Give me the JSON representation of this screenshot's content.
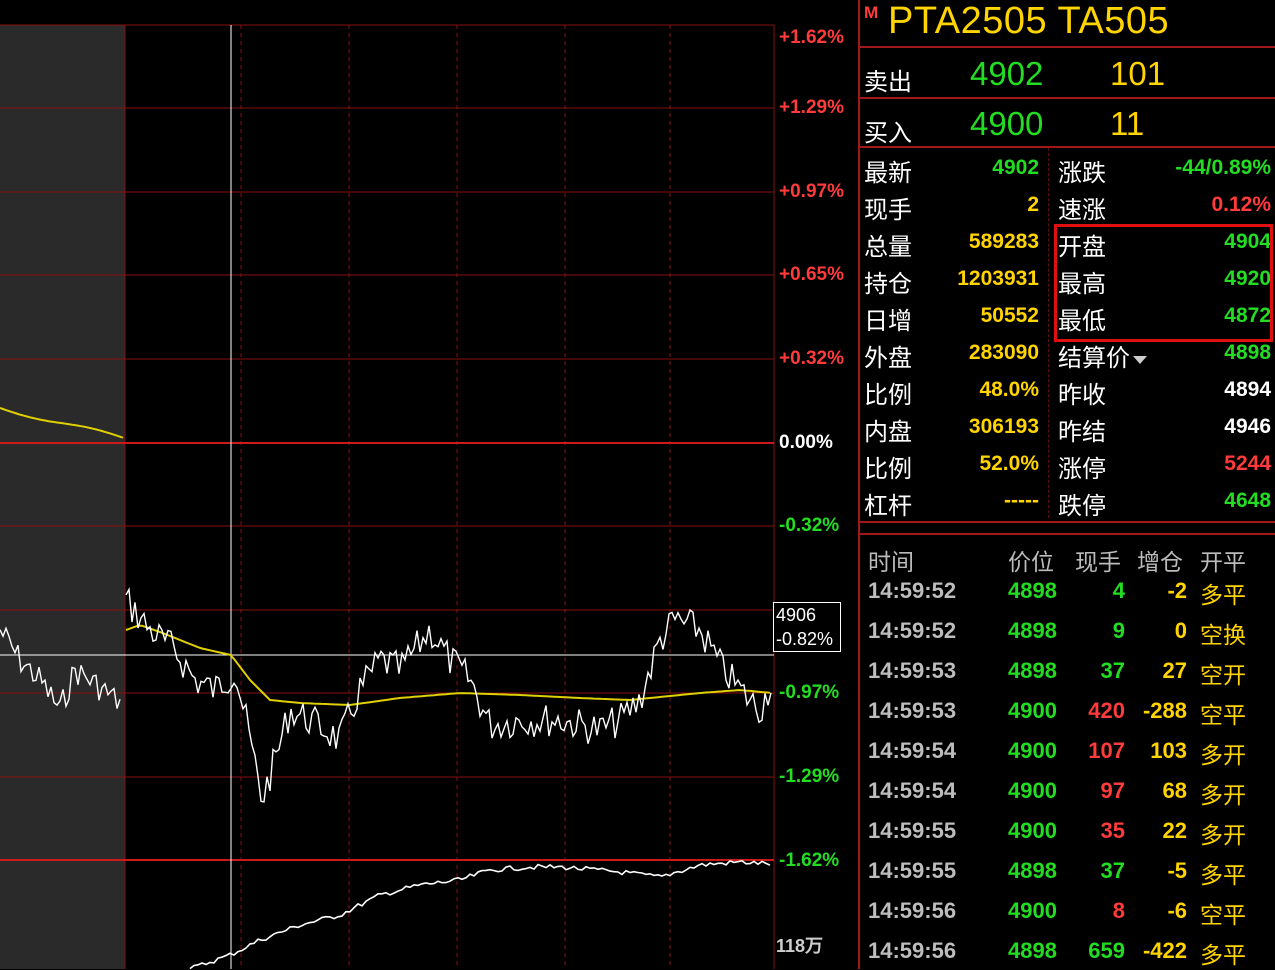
{
  "chart": {
    "pct_labels": [
      "+1.62%",
      "+1.29%",
      "+0.97%",
      "+0.65%",
      "+0.32%",
      "0.00%",
      "-0.32%",
      "-0.97%",
      "-1.29%",
      "-1.62%"
    ],
    "volume_label": "118万",
    "crosshair": {
      "price": "4906",
      "pct": "-0.82%"
    }
  },
  "instrument": {
    "badge": "M",
    "title": "PTA2505  TA505"
  },
  "orderbook": {
    "sell": {
      "label": "卖出",
      "price": "4902",
      "volume": "101"
    },
    "buy": {
      "label": "买入",
      "price": "4900",
      "volume": "11"
    }
  },
  "quote_left": [
    {
      "label": "最新",
      "value": "4902",
      "color": "green"
    },
    {
      "label": "现手",
      "value": "2",
      "color": "yellow"
    },
    {
      "label": "总量",
      "value": "589283",
      "color": "yellow"
    },
    {
      "label": "持仓",
      "value": "1203931",
      "color": "yellow"
    },
    {
      "label": "日增",
      "value": "50552",
      "color": "yellow"
    },
    {
      "label": "外盘",
      "value": "283090",
      "color": "yellow"
    },
    {
      "label": "比例",
      "value": "48.0%",
      "color": "yellow"
    },
    {
      "label": "内盘",
      "value": "306193",
      "color": "yellow"
    },
    {
      "label": "比例",
      "value": "52.0%",
      "color": "yellow"
    },
    {
      "label": "杠杆",
      "value": "-----",
      "color": "yellow"
    }
  ],
  "quote_right": [
    {
      "label": "涨跌",
      "value": "-44/0.89%",
      "color": "green"
    },
    {
      "label": "速涨",
      "value": "0.12%",
      "color": "red"
    },
    {
      "label": "开盘",
      "value": "4904",
      "color": "green"
    },
    {
      "label": "最高",
      "value": "4920",
      "color": "green"
    },
    {
      "label": "最低",
      "value": "4872",
      "color": "green"
    },
    {
      "label": "结算价",
      "value": "4898",
      "color": "green"
    },
    {
      "label": "昨收",
      "value": "4894",
      "color": "white"
    },
    {
      "label": "昨结",
      "value": "4946",
      "color": "white"
    },
    {
      "label": "涨停",
      "value": "5244",
      "color": "red"
    },
    {
      "label": "跌停",
      "value": "4648",
      "color": "green"
    }
  ],
  "trades": {
    "headers": [
      "时间",
      "价位",
      "现手",
      "增仓",
      "开平"
    ],
    "rows": [
      {
        "time": "14:59:52",
        "price": "4898",
        "qty": "4",
        "qty_color": "green",
        "oi": "-2",
        "type": "多平"
      },
      {
        "time": "14:59:52",
        "price": "4898",
        "qty": "9",
        "qty_color": "green",
        "oi": "0",
        "type": "空换"
      },
      {
        "time": "14:59:53",
        "price": "4898",
        "qty": "37",
        "qty_color": "green",
        "oi": "27",
        "type": "空开"
      },
      {
        "time": "14:59:53",
        "price": "4900",
        "qty": "420",
        "qty_color": "red",
        "oi": "-288",
        "type": "空平"
      },
      {
        "time": "14:59:54",
        "price": "4900",
        "qty": "107",
        "qty_color": "red",
        "oi": "103",
        "type": "多开"
      },
      {
        "time": "14:59:54",
        "price": "4900",
        "qty": "97",
        "qty_color": "red",
        "oi": "68",
        "type": "多开"
      },
      {
        "time": "14:59:55",
        "price": "4900",
        "qty": "35",
        "qty_color": "red",
        "oi": "22",
        "type": "多开"
      },
      {
        "time": "14:59:55",
        "price": "4898",
        "qty": "37",
        "qty_color": "green",
        "oi": "-5",
        "type": "多平"
      },
      {
        "time": "14:59:56",
        "price": "4900",
        "qty": "8",
        "qty_color": "red",
        "oi": "-6",
        "type": "空平"
      },
      {
        "time": "14:59:56",
        "price": "4898",
        "qty": "659",
        "qty_color": "green",
        "oi": "-422",
        "type": "多平"
      }
    ]
  },
  "colors": {
    "green": "#22dd22",
    "red": "#ff3b3b",
    "yellow": "#ffd400",
    "white": "#ffffff",
    "grid": "#a01818"
  }
}
